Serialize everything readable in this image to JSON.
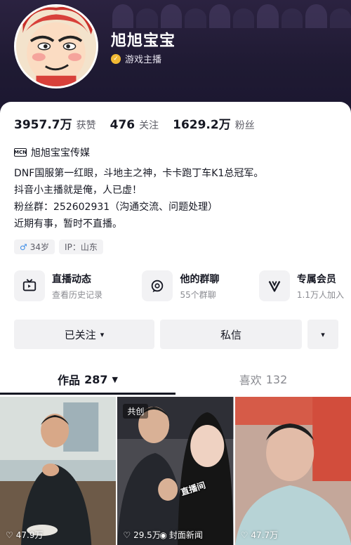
{
  "profile": {
    "nickname": "旭旭宝宝",
    "verify_label": "游戏主播",
    "avatar_caption": "旭旭宝宝"
  },
  "stats": [
    {
      "value": "3957.7万",
      "label": "获赞"
    },
    {
      "value": "476",
      "label": "关注"
    },
    {
      "value": "1629.2万",
      "label": "粉丝"
    }
  ],
  "mcn": {
    "badge": "MCN",
    "name": "旭旭宝宝传媒"
  },
  "bio": [
    "DNF国服第一红眼，斗地主之神，卡卡跑丁车K1总冠军。",
    "抖音小主播就是俺，人已虚！",
    "粉丝群：252602931（沟通交流、问题处理）",
    "近期有事，暂时不直播。"
  ],
  "tags": {
    "gender_symbol": "♂",
    "age": "34岁",
    "ip": "IP：山东"
  },
  "features": [
    {
      "title": "直播动态",
      "subtitle": "查看历史记录",
      "icon": "tv-icon"
    },
    {
      "title": "他的群聊",
      "subtitle": "55个群聊",
      "icon": "chat-icon"
    },
    {
      "title": "专属会员",
      "subtitle": "1.1万人加入",
      "icon": "v-member-icon"
    }
  ],
  "actions": {
    "follow": "已关注",
    "message": "私信",
    "more_symbol": "▾"
  },
  "tabs": {
    "works_label": "作品",
    "works_count": "287",
    "likes_label": "喜欢",
    "likes_count": "132"
  },
  "videos": [
    {
      "likes": "47.9万"
    },
    {
      "likes": "29.5万",
      "badge": "共创",
      "sticker": "直播间"
    },
    {
      "likes": "47.7万"
    }
  ],
  "watermark": "封面新闻",
  "colors": {
    "header_bg": "#1f1a33",
    "verify_badge": "#f1b934",
    "accent_male": "#3c8ce7"
  }
}
